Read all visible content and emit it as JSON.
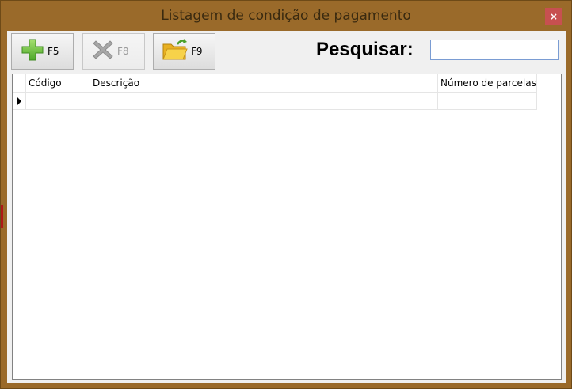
{
  "window": {
    "title": "Listagem de condição de pagamento",
    "close_glyph": "×"
  },
  "toolbar": {
    "buttons": [
      {
        "label": "F5",
        "icon": "add-icon",
        "color": "#6abf3a",
        "enabled": true
      },
      {
        "label": "F8",
        "icon": "delete-icon",
        "color": "#a0a0a0",
        "enabled": false
      },
      {
        "label": "F9",
        "icon": "open-folder-icon",
        "color": "#f0c020",
        "enabled": true
      }
    ]
  },
  "search": {
    "label": "Pesquisar:",
    "value": "",
    "placeholder": ""
  },
  "grid": {
    "columns": [
      "Código",
      "Descrição",
      "Número de parcelas"
    ],
    "rows": [
      {
        "codigo": "",
        "descricao": "",
        "parcelas": ""
      }
    ]
  },
  "colors": {
    "window_frame": "#9a6a2a",
    "close_button": "#c75050",
    "client_background": "#f0f0f0"
  }
}
